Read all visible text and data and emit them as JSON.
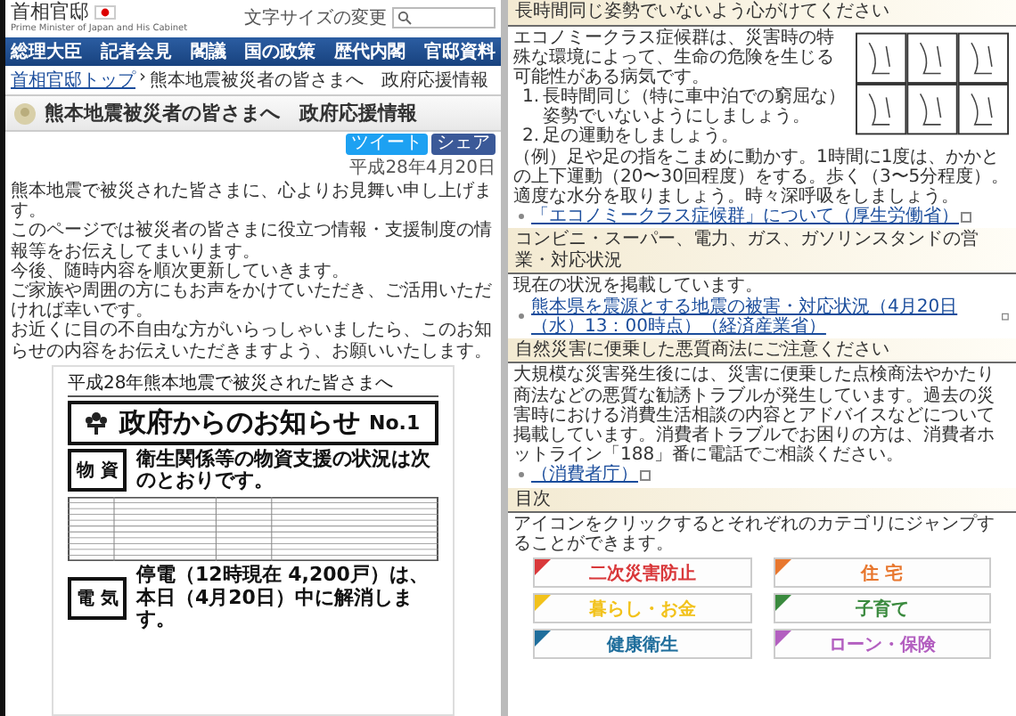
{
  "left": {
    "logo": {
      "title": "首相官邸",
      "subtitle": "Prime Minister of Japan and His Cabinet"
    },
    "font_size_label": "文字サイズの変更",
    "nav": [
      "総理大臣",
      "記者会見",
      "閣議",
      "国の政策",
      "歴代内閣",
      "官邸資料"
    ],
    "breadcrumb": {
      "home": "首相官邸トップ",
      "separator": "›",
      "current": "熊本地震被災者の皆さまへ　政府応援情報"
    },
    "page_title": "熊本地震被災者の皆さまへ　政府応援情報",
    "share_buttons": [
      "ツイート",
      "シェア"
    ],
    "date": "平成28年4月20日",
    "paragraphs": [
      "熊本地震で被災された皆さまに、心よりお見舞い申し上げます。",
      "このページでは被災者の皆さまに役立つ情報・支援制度の情報等をお伝えしてまいります。",
      "今後、随時内容を順次更新していきます。",
      "ご家族や周囲の方にもお声をかけていただき、ご活用いただければ幸いです。",
      "お近くに目の不自由な方がいらっしゃいましたら、このお知らせの内容をお伝えいただきますよう、お願いいたします。"
    ],
    "notice": {
      "heading": "平成28年熊本地震で被災された皆さまへ",
      "title": "政府からのお知らせ",
      "number": "No.1",
      "items": [
        {
          "tag": "物 資",
          "text": "衛生関係等の物資支援の状況は次のとおりです。",
          "kind": "table"
        },
        {
          "tag": "電 気",
          "text": "停電（12時現在 4,200戸）は、本日（4月20日）中に解消します。",
          "kind": "plain"
        }
      ]
    }
  },
  "right": {
    "sections": [
      {
        "heading": "長時間同じ姿勢でいないよう心がけてください",
        "kind": "economy",
        "intro": "エコノミークラス症候群は、災害時の特殊な環境によって、生命の危険を生じる可能性がある病気です。",
        "steps": [
          {
            "number": "1.",
            "text": "長時間同じ（特に車中泊での窮屈な）姿勢でいないようにしましょう。"
          },
          {
            "number": "2.",
            "text": "足の運動をしましょう。"
          }
        ],
        "example": "（例）足や足の指をこまめに動かす。1時間に1度は、かかとの上下運動（20〜30回程度）をする。歩く（3〜5分程度）。適度な水分を取りましょう。時々深呼吸をしましょう。",
        "link": "「エコノミークラス症候群」について（厚生労働省）"
      },
      {
        "heading": "コンビニ・スーパー、電力、ガス、ガソリンスタンドの営業・対応状況",
        "kind": "text",
        "body": "現在の状況を掲載しています。",
        "link": "熊本県を震源とする地震の被害・対応状況（4月20日（水）13：00時点）（経済産業省）"
      },
      {
        "heading": "自然災害に便乗した悪質商法にご注意ください",
        "kind": "text",
        "body": "大規模な災害発生後には、災害に便乗した点検商法やかたり商法などの悪質な勧誘トラブルが発生しています。過去の災害時における消費生活相談の内容とアドバイスなどについて掲載しています。消費者トラブルでお困りの方は、消費者ホットライン「188」番に電話でご相談ください。",
        "link": "（消費者庁）"
      },
      {
        "heading": "目次",
        "kind": "toc",
        "body": "アイコンをクリックするとそれぞれのカテゴリにジャンプすることができます。",
        "tiles": [
          {
            "label": "二次災害防止",
            "color": "#d9383a"
          },
          {
            "label": "住 宅",
            "color": "#e8772e"
          },
          {
            "label": "暮らし・お金",
            "color": "#f2c21b"
          },
          {
            "label": "子育て",
            "color": "#3a8a3e"
          },
          {
            "label": "健康衛生",
            "color": "#1f6e9c"
          },
          {
            "label": "ローン・保険",
            "color": "#b35fc0"
          }
        ]
      }
    ]
  }
}
